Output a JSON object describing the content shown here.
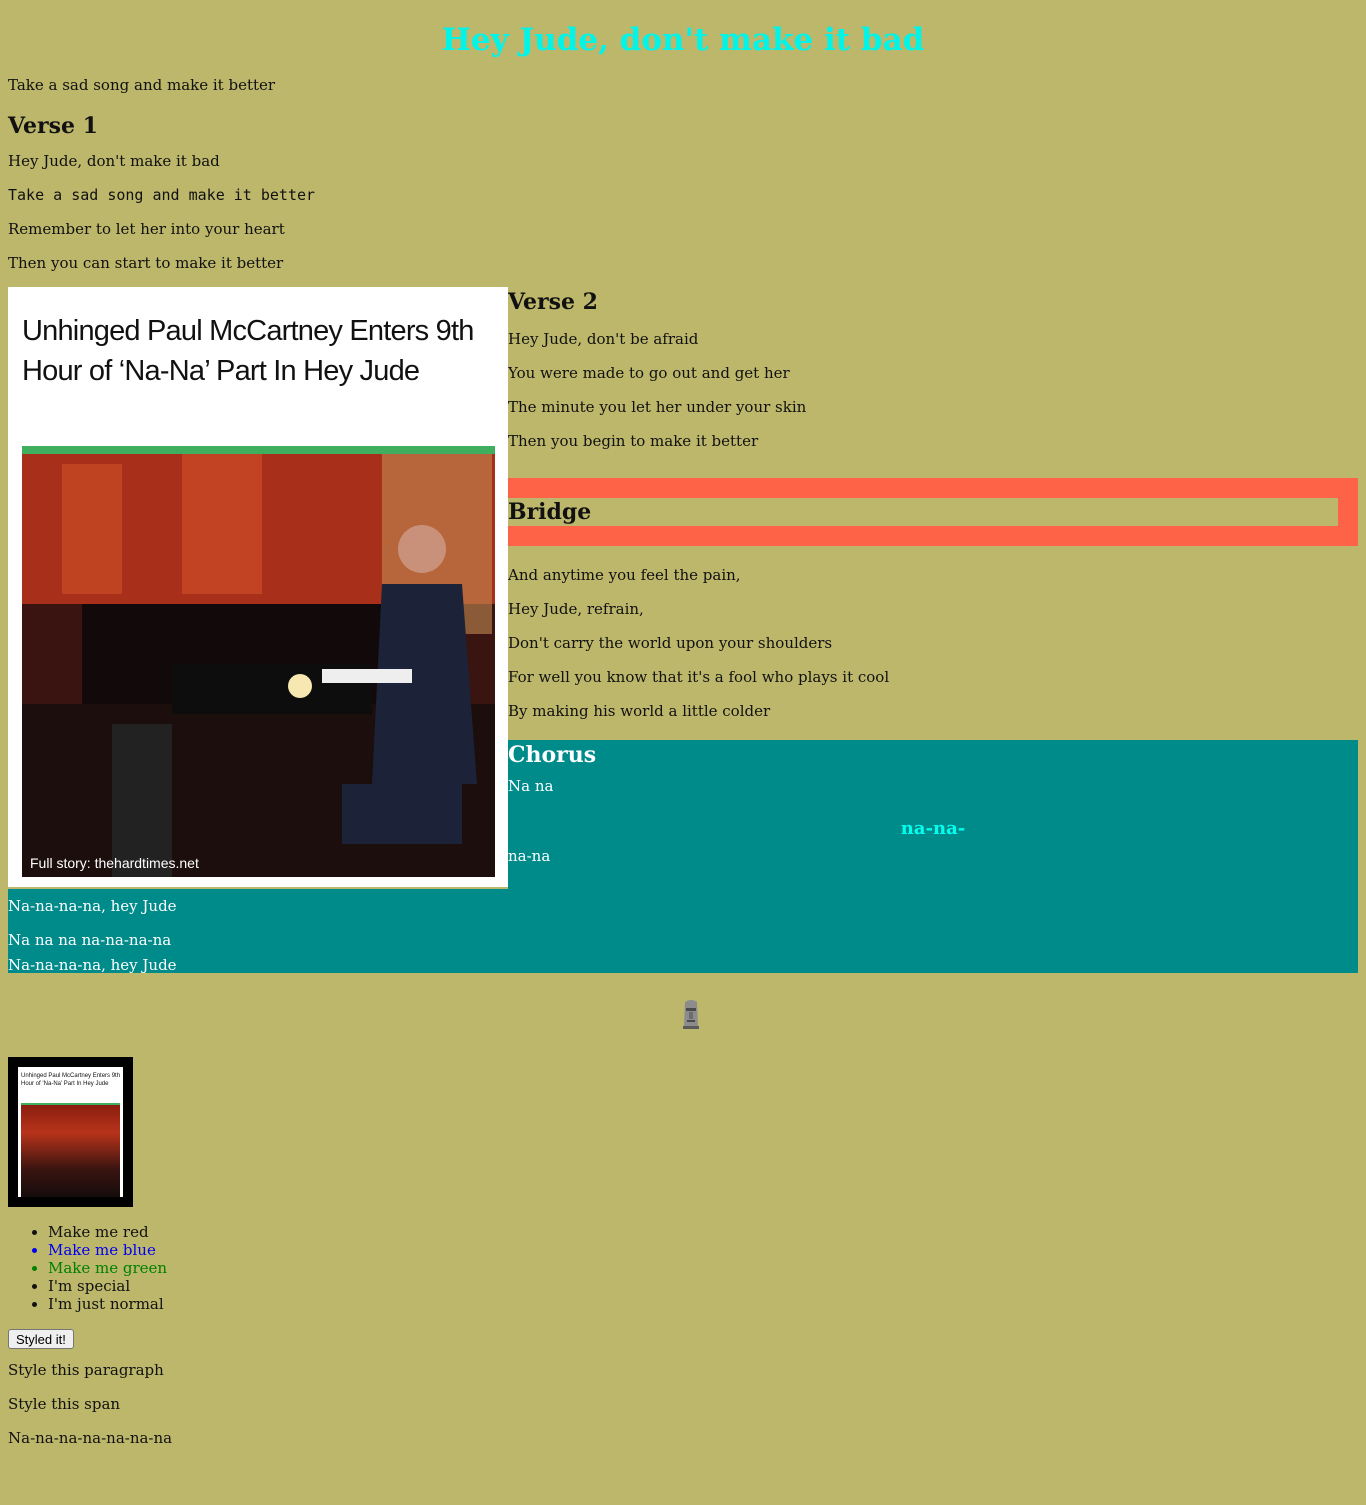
{
  "title": "Hey Jude, don't make it bad",
  "intro": "Take a sad song and make it better",
  "verse1": {
    "heading": "Verse 1",
    "lines": [
      "Hey Jude, don't make it bad",
      "Take a sad song and make it better",
      "Remember to let her into your heart",
      "Then you can start to make it better"
    ]
  },
  "article_image": {
    "headline": "Unhinged Paul McCartney Enters 9th Hour of ‘Na-Na’ Part In Hey Jude",
    "caption": "Full story: thehardtimes.net"
  },
  "verse2": {
    "heading": "Verse 2",
    "lines": [
      "Hey Jude, don't be afraid",
      "You were made to go out and get her",
      "The minute you let her under your skin",
      "Then you begin to make it better"
    ]
  },
  "bridge": {
    "heading": "Bridge",
    "lines": [
      "And anytime you feel the pain,",
      "Hey Jude, refrain,",
      "Don't carry the world upon your shoulders",
      "For well you know that it's a fool who plays it cool",
      "By making his world a little colder"
    ]
  },
  "chorus": {
    "heading": "Chorus",
    "line1": "Na na",
    "highlight": "na-na-",
    "line2": "na-na",
    "lines": [
      "Na-na-na-na, hey Jude",
      "Na na na na-na-na-na",
      "Na-na-na-na, hey Jude"
    ]
  },
  "moai_icon": "moai-emoji-icon",
  "list": [
    {
      "label": "Make me red",
      "color": "#111111"
    },
    {
      "label": "Make me blue",
      "color": "#0000EE"
    },
    {
      "label": "Make me green",
      "color": "#008000"
    },
    {
      "label": "I'm special",
      "color": "#111111"
    },
    {
      "label": "I'm just normal",
      "color": "#111111"
    }
  ],
  "button_label": "Styled it!",
  "tail": [
    "Style this paragraph",
    "Style this span",
    "Na-na-na-na-na-na-na"
  ],
  "colors": {
    "background": "#BDB76B",
    "title": "#00F5E8",
    "bridge_border": "#FF6347",
    "chorus_bg": "#008B8B"
  }
}
